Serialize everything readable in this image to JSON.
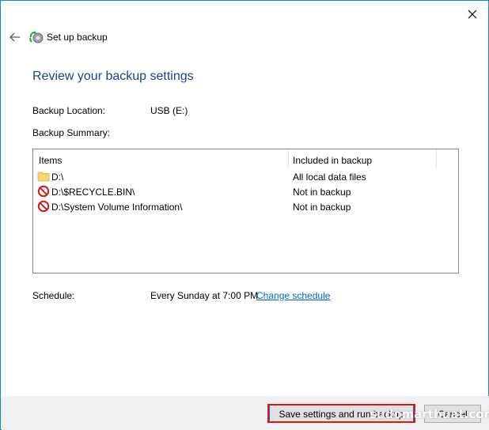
{
  "window": {
    "title": "Set up backup",
    "heading": "Review your backup settings"
  },
  "settings": {
    "location_label": "Backup Location:",
    "location_value": "USB (E:)",
    "summary_label": "Backup Summary:",
    "schedule_label": "Schedule:",
    "schedule_value": "Every Sunday at 7:00 PM",
    "change_schedule_link": "Change schedule"
  },
  "summary_table": {
    "columns": [
      "Items",
      "Included in backup"
    ],
    "rows": [
      {
        "icon": "folder-icon",
        "item": "D:\\",
        "status": "All local data files"
      },
      {
        "icon": "excluded-icon",
        "item": "D:\\$RECYCLE.BIN\\",
        "status": "Not in backup"
      },
      {
        "icon": "excluded-icon",
        "item": "D:\\System Volume Information\\",
        "status": "Not in backup"
      }
    ]
  },
  "buttons": {
    "save_run": "Save settings and run backup",
    "cancel": "Cancel"
  },
  "watermark": "sudomarthuat.com",
  "colors": {
    "heading": "#1e3f8f",
    "link": "#0066cc",
    "highlight": "#e0141e",
    "window_border": "#1883d7"
  }
}
